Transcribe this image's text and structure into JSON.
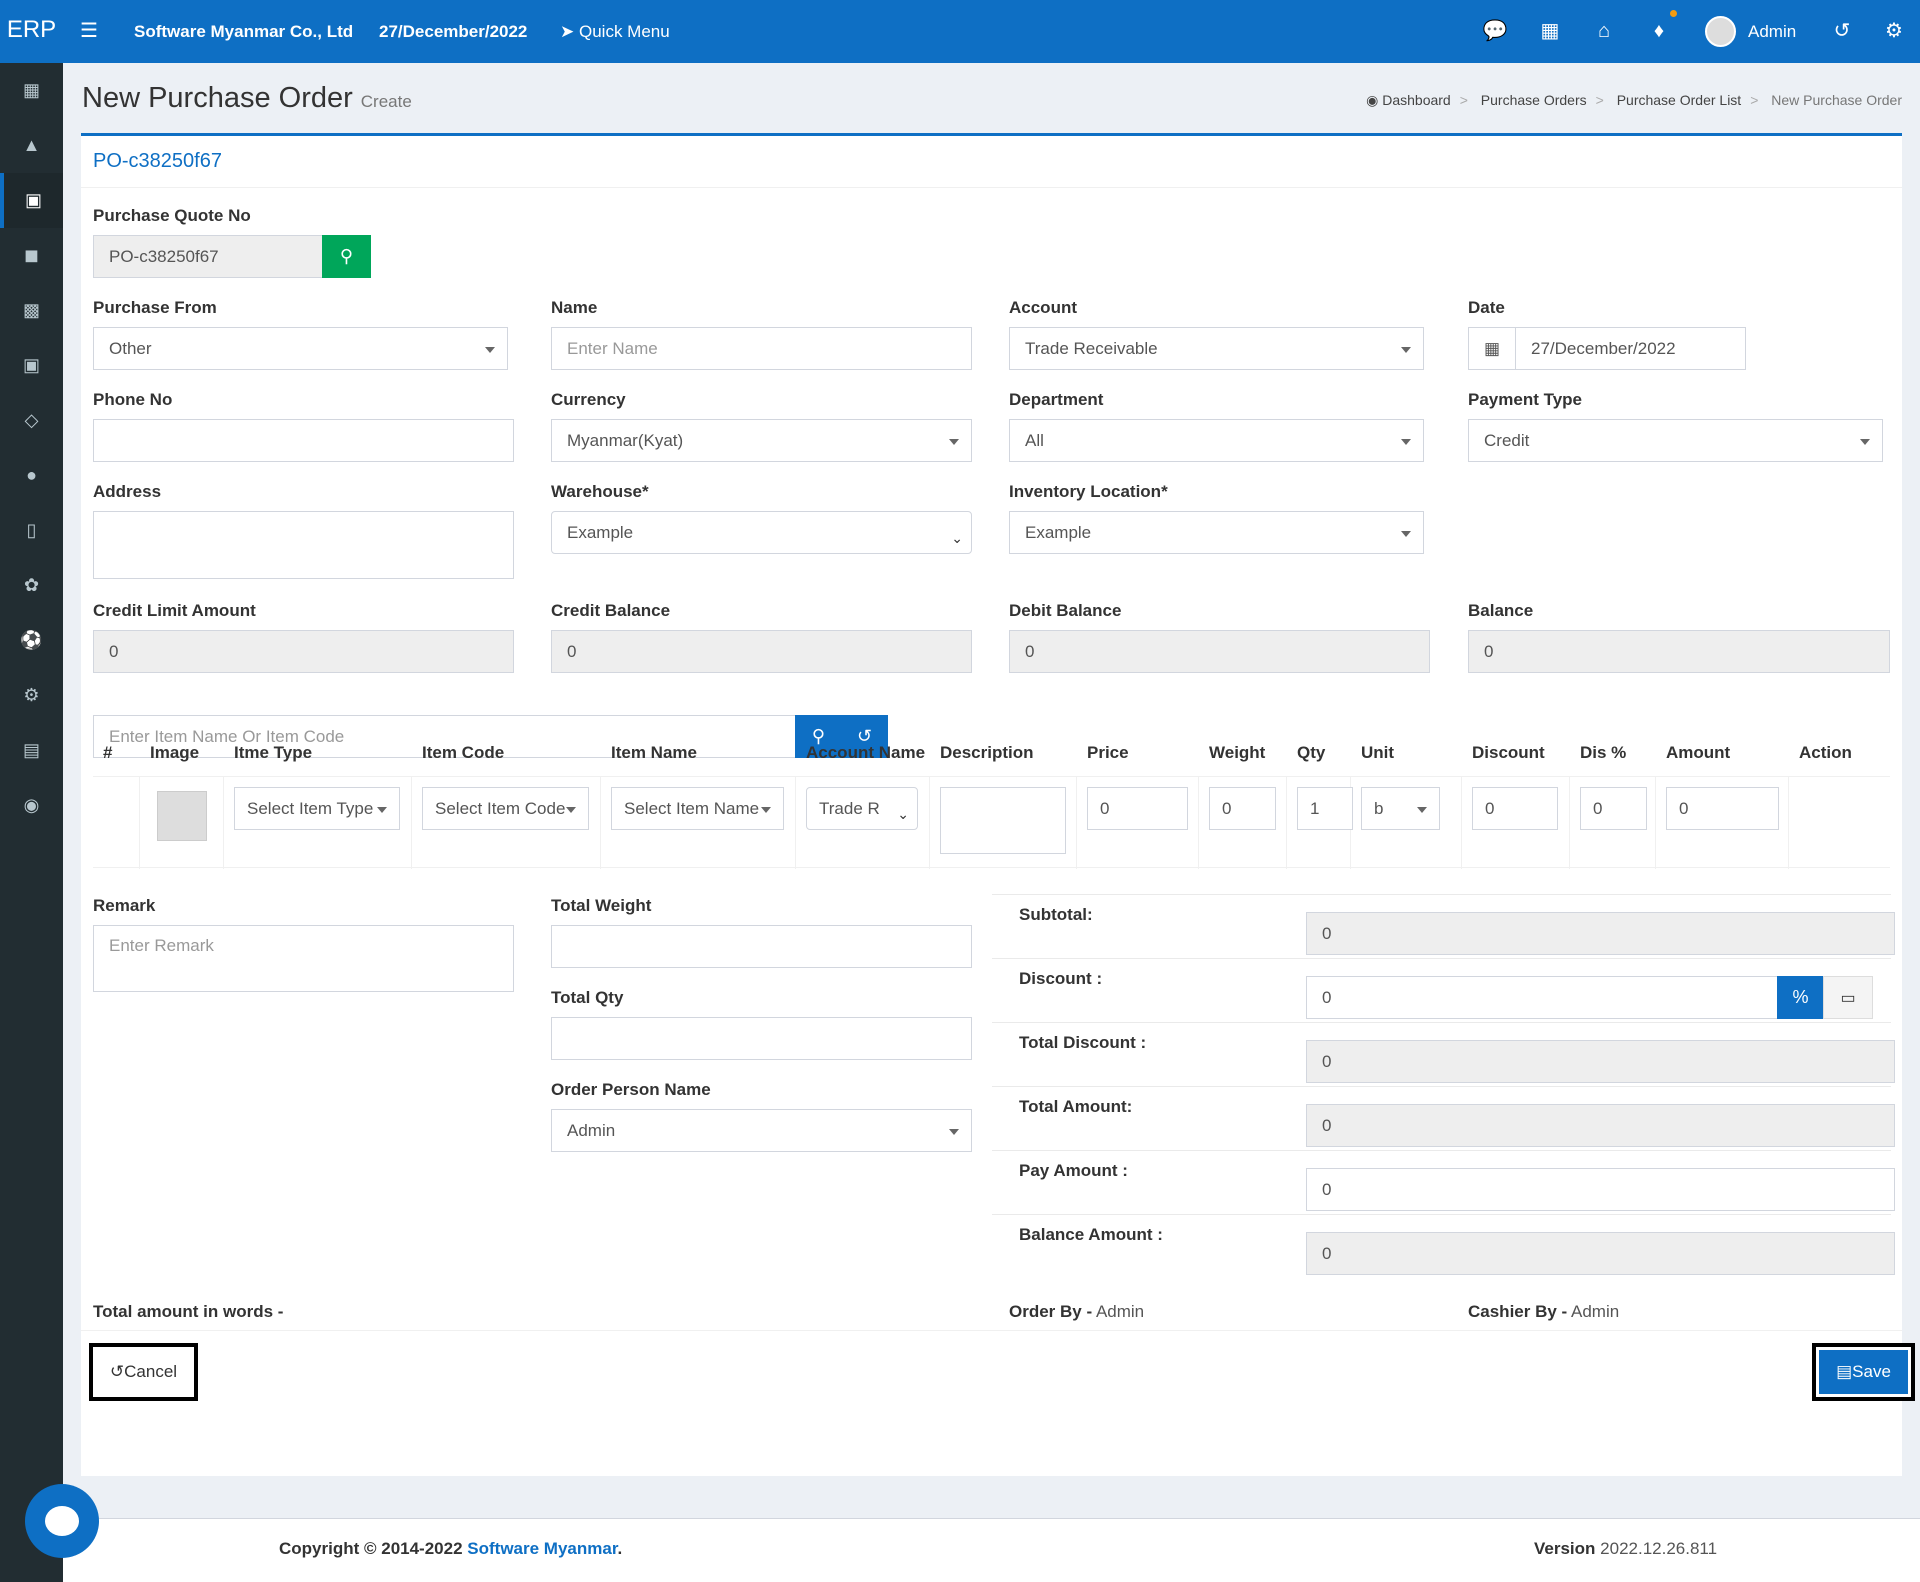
{
  "topbar": {
    "brand": "ERP",
    "company": "Software Myanmar Co., Ltd",
    "date": "27/December/2022",
    "quick_menu": "Quick Menu",
    "user": "Admin"
  },
  "page": {
    "title": "New Purchase Order",
    "subtitle": "Create",
    "breadcrumb": [
      "Dashboard",
      "Purchase Orders",
      "Purchase Order List",
      "New Purchase Order"
    ]
  },
  "form": {
    "po_number": "PO-c38250f67",
    "purchase_quote_no": {
      "label": "Purchase Quote No",
      "value": "PO-c38250f67"
    },
    "purchase_from": {
      "label": "Purchase From",
      "value": "Other"
    },
    "name": {
      "label": "Name",
      "placeholder": "Enter Name"
    },
    "account": {
      "label": "Account",
      "value": "Trade Receivable"
    },
    "date": {
      "label": "Date",
      "value": "27/December/2022"
    },
    "phone": {
      "label": "Phone No",
      "value": ""
    },
    "currency": {
      "label": "Currency",
      "value": "Myanmar(Kyat)"
    },
    "department": {
      "label": "Department",
      "value": "All"
    },
    "payment_type": {
      "label": "Payment Type",
      "value": "Credit"
    },
    "address": {
      "label": "Address",
      "value": ""
    },
    "warehouse": {
      "label": "Warehouse*",
      "value": "Example"
    },
    "inventory_location": {
      "label": "Inventory Location*",
      "value": "Example"
    },
    "credit_limit": {
      "label": "Credit Limit Amount",
      "value": "0"
    },
    "credit_balance": {
      "label": "Credit Balance",
      "value": "0"
    },
    "debit_balance": {
      "label": "Debit Balance",
      "value": "0"
    },
    "balance": {
      "label": "Balance",
      "value": "0"
    },
    "item_search": {
      "placeholder": "Enter Item Name Or Item Code"
    }
  },
  "table": {
    "headers": [
      "#",
      "Image",
      "Itme Type",
      "Item Code",
      "Item Name",
      "Account Name",
      "Description",
      "Price",
      "Weight",
      "Qty",
      "Unit",
      "Discount",
      "Dis %",
      "Amount",
      "Action"
    ],
    "row": {
      "item_type": "Select Item Type",
      "item_code": "Select Item Code",
      "item_name": "Select Item Name",
      "account_name": "Trade R",
      "price": "0",
      "weight": "0",
      "qty": "1",
      "unit": "b",
      "discount": "0",
      "dis_percent": "0",
      "amount": "0"
    }
  },
  "bottom": {
    "remark": {
      "label": "Remark",
      "placeholder": "Enter Remark"
    },
    "total_weight": {
      "label": "Total Weight",
      "value": ""
    },
    "total_qty": {
      "label": "Total Qty",
      "value": ""
    },
    "order_person": {
      "label": "Order Person Name",
      "value": "Admin"
    },
    "subtotal": {
      "label": "Subtotal:",
      "value": "0"
    },
    "discount": {
      "label": "Discount :",
      "value": "0",
      "percent_symbol": "%"
    },
    "total_discount": {
      "label": "Total Discount :",
      "value": "0"
    },
    "total_amount": {
      "label": "Total Amount:",
      "value": "0"
    },
    "pay_amount": {
      "label": "Pay Amount :",
      "value": "0"
    },
    "balance_amount": {
      "label": "Balance Amount :",
      "value": "0"
    },
    "amount_words_label": "Total amount in words -",
    "order_by_label": "Order By -",
    "order_by_value": "Admin",
    "cashier_by_label": "Cashier By -",
    "cashier_by_value": "Admin"
  },
  "buttons": {
    "cancel": "Cancel",
    "save": "Save"
  },
  "footer": {
    "copyright": "Copyright © 2014-2022",
    "company_link": "Software Myanmar",
    "period": ".",
    "version_label": "Version",
    "version_value": "2022.12.26.811"
  },
  "colors": {
    "primary": "#0e6fc4",
    "success": "#00a65a",
    "sidebar": "#222d32"
  }
}
